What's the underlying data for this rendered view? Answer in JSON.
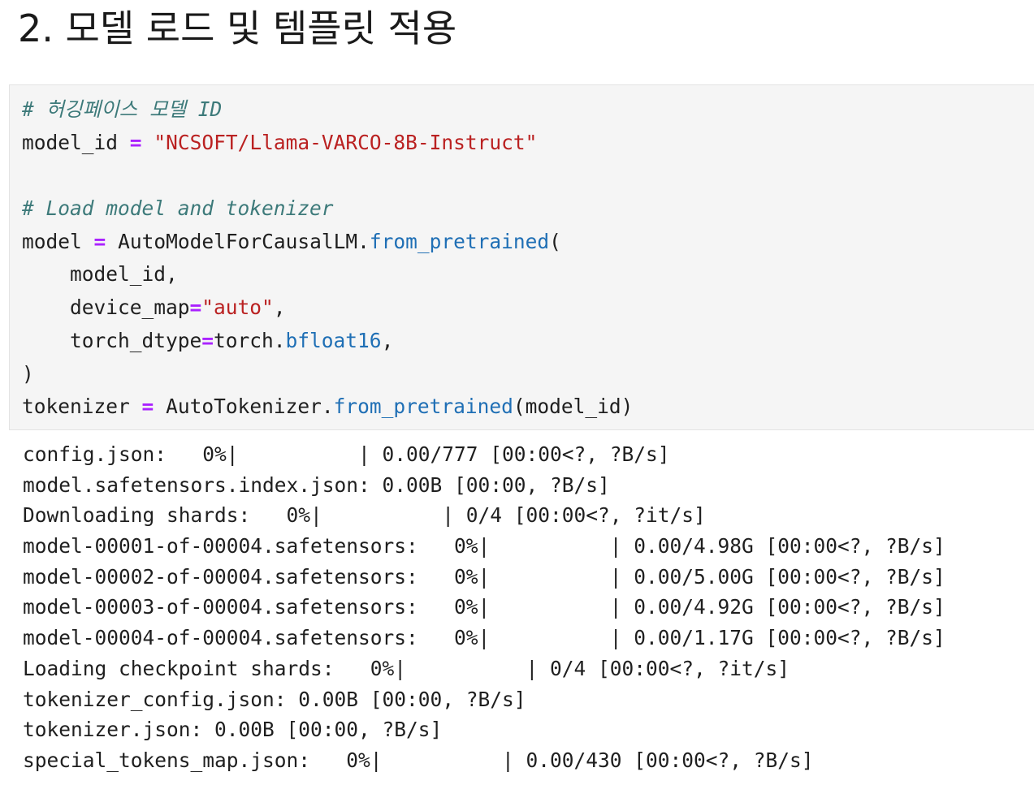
{
  "heading": "2. 모델 로드 및 템플릿 적용",
  "code": {
    "comment1": "# 허깅페이스 모델 ID",
    "line2": {
      "var": "model_id",
      "eq": "=",
      "str": "\"NCSOFT/Llama-VARCO-8B-Instruct\""
    },
    "comment2": "# Load model and tokenizer",
    "line5": {
      "var": "model",
      "eq": "=",
      "cls": "AutoModelForCausalLM.",
      "method": "from_pretrained",
      "paren": "("
    },
    "line6": "    model_id,",
    "line7": {
      "indent": "    device_map",
      "eq": "=",
      "str": "\"auto\"",
      "tail": ","
    },
    "line8": {
      "indent": "    torch_dtype",
      "eq": "=",
      "obj": "torch.",
      "attr": "bfloat16",
      "tail": ","
    },
    "line9": ")",
    "line10": {
      "var": "tokenizer",
      "eq": "=",
      "cls": "AutoTokenizer.",
      "method": "from_pretrained",
      "args": "(model_id)"
    }
  },
  "output": [
    "config.json:   0%|          | 0.00/777 [00:00<?, ?B/s]",
    "model.safetensors.index.json: 0.00B [00:00, ?B/s]",
    "Downloading shards:   0%|          | 0/4 [00:00<?, ?it/s]",
    "model-00001-of-00004.safetensors:   0%|          | 0.00/4.98G [00:00<?, ?B/s]",
    "model-00002-of-00004.safetensors:   0%|          | 0.00/5.00G [00:00<?, ?B/s]",
    "model-00003-of-00004.safetensors:   0%|          | 0.00/4.92G [00:00<?, ?B/s]",
    "model-00004-of-00004.safetensors:   0%|          | 0.00/1.17G [00:00<?, ?B/s]",
    "Loading checkpoint shards:   0%|          | 0/4 [00:00<?, ?it/s]",
    "tokenizer_config.json: 0.00B [00:00, ?B/s]",
    "tokenizer.json: 0.00B [00:00, ?B/s]",
    "special_tokens_map.json:   0%|          | 0.00/430 [00:00<?, ?B/s]"
  ]
}
